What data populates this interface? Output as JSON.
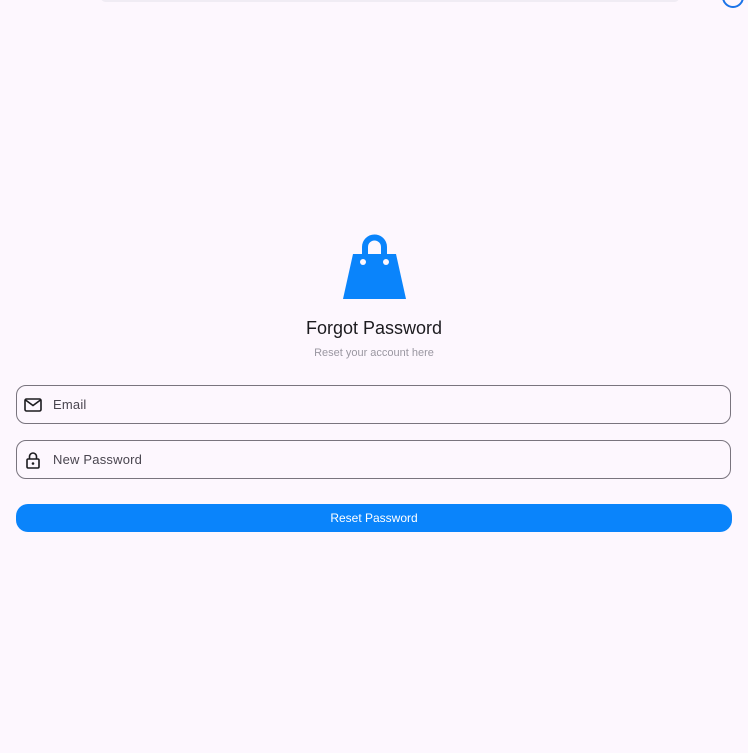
{
  "colors": {
    "background": "#fdf7fe",
    "accent": "#0a84fb",
    "outline": "#79747e",
    "title": "#1c1b1f",
    "subtitle": "#9a97a1"
  },
  "logo": {
    "icon": "shopping-bag-icon"
  },
  "header": {
    "title": "Forgot Password",
    "subtitle": "Reset your account here"
  },
  "form": {
    "email": {
      "icon": "mail-icon",
      "placeholder": "Email",
      "value": ""
    },
    "new_password": {
      "icon": "lock-icon",
      "placeholder": "New Password",
      "value": ""
    },
    "submit_label": "Reset Password"
  }
}
